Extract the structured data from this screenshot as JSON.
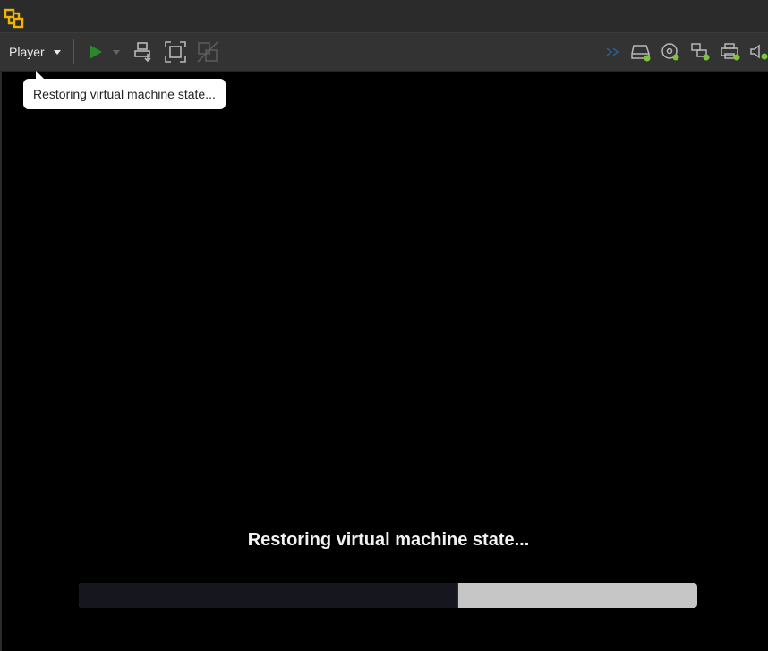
{
  "toolbar": {
    "player_label": "Player",
    "icons": {
      "play": "play-icon",
      "send_ctrl_alt_del": "send-ctrl-alt-del-icon",
      "full_screen": "full-screen-icon",
      "unity": "unity-icon",
      "devices": [
        "network-icon",
        "hard-disk-icon",
        "cd-dvd-icon",
        "network-adapter-icon",
        "printer-icon",
        "sound-icon"
      ]
    },
    "colors": {
      "device_active": "#7dc43a",
      "play": "#2a8a2a"
    }
  },
  "tooltip": {
    "text": "Restoring virtual machine state..."
  },
  "status": {
    "message": "Restoring virtual machine state...",
    "progress": 0.61
  }
}
